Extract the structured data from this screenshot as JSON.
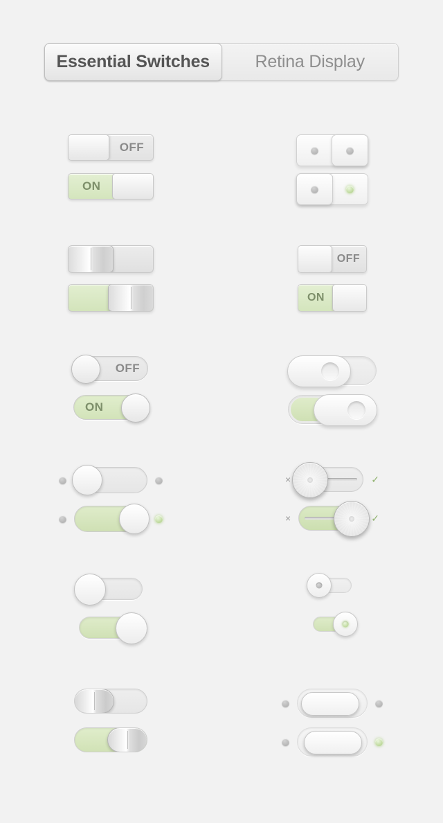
{
  "page": {
    "background_color": "#f2f2f2",
    "accent_green": "#d4e5bd",
    "accent_green_text": "#7d8f6a",
    "off_text_color": "#8a8a8a"
  },
  "segmented_control": {
    "segments": [
      {
        "label": "Essential Switches",
        "selected": true
      },
      {
        "label": "Retina Display",
        "selected": false
      }
    ]
  },
  "switch_rows": [
    {
      "left": {
        "style": "rectangular-labelled",
        "off": {
          "label": "OFF",
          "state": "off"
        },
        "on": {
          "label": "ON",
          "state": "on"
        }
      },
      "right": {
        "style": "two-pane-led",
        "off": {
          "left_led": "grey",
          "right_led": "grey",
          "state": "off"
        },
        "on": {
          "left_led": "grey",
          "right_led": "green",
          "state": "on"
        }
      }
    },
    {
      "left": {
        "style": "grooved-rectangular",
        "off": {
          "state": "off"
        },
        "on": {
          "state": "on"
        }
      },
      "right": {
        "style": "small-rectangular-labelled",
        "off": {
          "label": "OFF",
          "state": "off"
        },
        "on": {
          "label": "ON",
          "state": "on"
        }
      }
    },
    {
      "left": {
        "style": "pill-labelled",
        "off": {
          "label": "OFF",
          "state": "off"
        },
        "on": {
          "label": "ON",
          "state": "on"
        }
      },
      "right": {
        "style": "lozenge-slider",
        "off": {
          "state": "off"
        },
        "on": {
          "state": "on"
        }
      }
    },
    {
      "left": {
        "style": "pill-with-leds",
        "off": {
          "left_led": "grey",
          "right_led": "grey",
          "state": "off"
        },
        "on": {
          "left_led": "grey",
          "right_led": "green",
          "state": "on"
        }
      },
      "right": {
        "style": "metal-knob-marks",
        "off": {
          "left_mark": "×",
          "right_mark": "✓",
          "state": "off"
        },
        "on": {
          "left_mark": "×",
          "right_mark": "✓",
          "state": "on"
        }
      }
    },
    {
      "left": {
        "style": "inset-track-pill",
        "off": {
          "state": "off"
        },
        "on": {
          "state": "on"
        }
      },
      "right": {
        "style": "mini-dot-knob",
        "off": {
          "dot": "grey",
          "state": "off"
        },
        "on": {
          "dot": "green",
          "state": "on"
        }
      }
    },
    {
      "left": {
        "style": "grooved-pill",
        "off": {
          "state": "off"
        },
        "on": {
          "state": "on"
        }
      },
      "right": {
        "style": "framed-lozenge-leds",
        "off": {
          "left_led": "grey",
          "right_led": "grey",
          "state": "off"
        },
        "on": {
          "left_led": "grey",
          "right_led": "green",
          "state": "on"
        }
      }
    }
  ]
}
